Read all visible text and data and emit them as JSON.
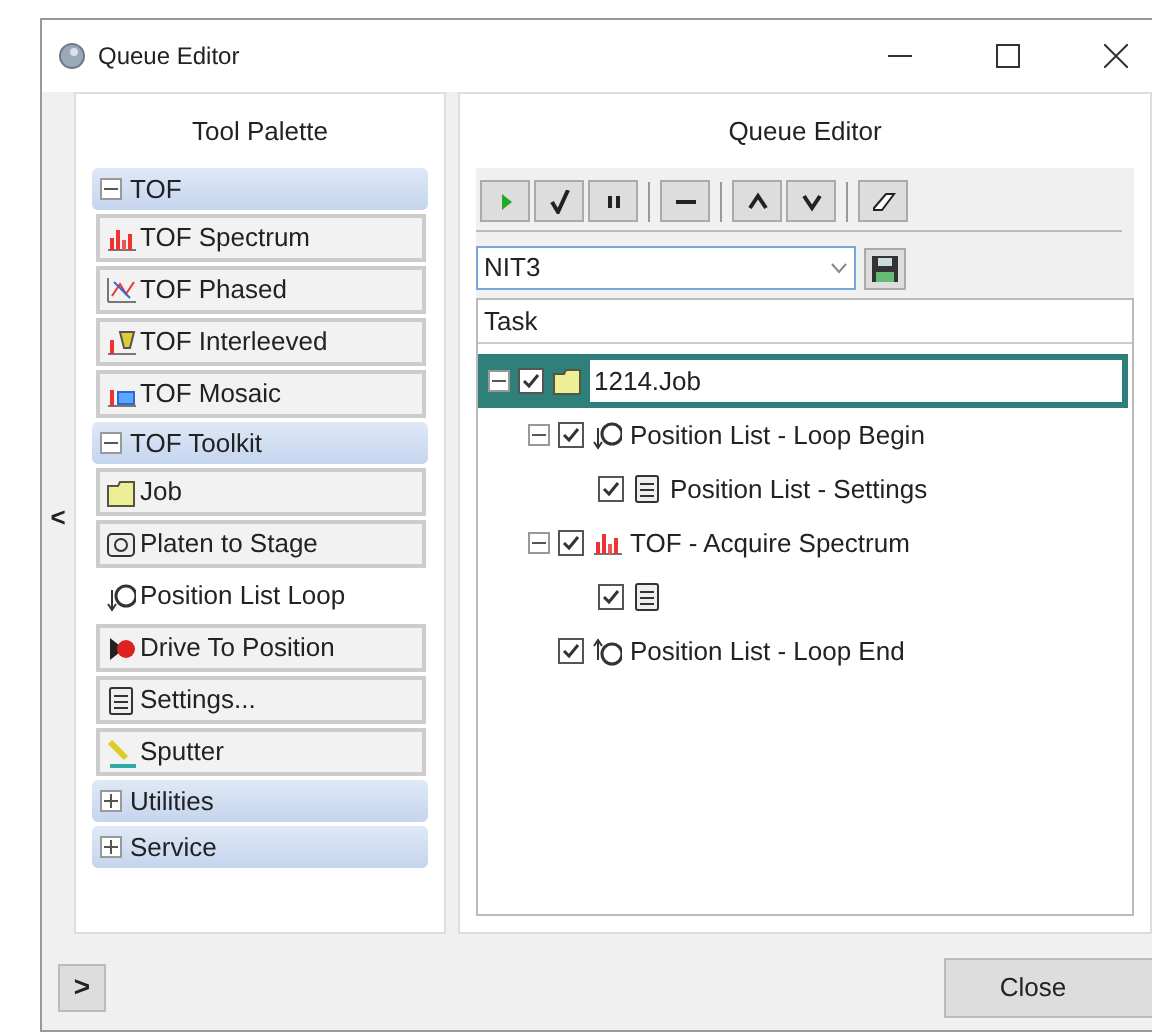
{
  "window": {
    "title": "Queue Editor"
  },
  "palette_toggle": {
    "label": "<"
  },
  "tool_palette": {
    "title": "Tool Palette",
    "groups": [
      {
        "label": "TOF",
        "expanded": true,
        "items": [
          {
            "label": "TOF Spectrum",
            "kind": "spectrum",
            "framed": true
          },
          {
            "label": "TOF Phased",
            "kind": "phased",
            "framed": true
          },
          {
            "label": "TOF Interleeved",
            "kind": "interleaved",
            "framed": true
          },
          {
            "label": "TOF Mosaic",
            "kind": "mosaic",
            "framed": true
          }
        ]
      },
      {
        "label": "TOF Toolkit",
        "expanded": true,
        "items": [
          {
            "label": "Job",
            "kind": "folder",
            "framed": true
          },
          {
            "label": "Platen to Stage",
            "kind": "platen",
            "framed": true
          },
          {
            "label": "Position List Loop",
            "kind": "loop",
            "framed": false
          },
          {
            "label": "Drive To Position",
            "kind": "drive",
            "framed": true
          },
          {
            "label": "Settings...",
            "kind": "settings",
            "framed": true
          },
          {
            "label": "Sputter",
            "kind": "sputter",
            "framed": true
          }
        ]
      },
      {
        "label": "Utilities",
        "expanded": false
      },
      {
        "label": "Service",
        "expanded": false
      }
    ]
  },
  "queue_editor": {
    "title": "Queue Editor",
    "toolbar": [
      {
        "kind": "play"
      },
      {
        "kind": "check"
      },
      {
        "kind": "pause"
      },
      {
        "kind": "sep"
      },
      {
        "kind": "minus"
      },
      {
        "kind": "sep"
      },
      {
        "kind": "up"
      },
      {
        "kind": "down"
      },
      {
        "kind": "sep"
      },
      {
        "kind": "eraser"
      }
    ],
    "queue_select": {
      "value": "NIT3"
    },
    "column": "Task",
    "tree": [
      {
        "label": "1214.Job",
        "kind": "folder",
        "checked": true,
        "expanded": true,
        "selected": true,
        "children": [
          {
            "label": "Position List - Loop Begin",
            "kind": "loop",
            "checked": true,
            "expanded": true,
            "selected": false,
            "children": [
              {
                "label": "Position List - Settings",
                "kind": "settings",
                "checked": true,
                "selected": false
              }
            ]
          },
          {
            "label": "TOF - Acquire Spectrum",
            "kind": "spectrum",
            "checked": true,
            "expanded": true,
            "selected": false,
            "children": [
              {
                "kind": "settings",
                "checked": true,
                "selected": false
              }
            ]
          },
          {
            "label": "Position List - Loop End",
            "kind": "loopend",
            "checked": true,
            "selected": false
          }
        ]
      }
    ]
  },
  "footer": {
    "expand": ">",
    "close": "Close"
  }
}
